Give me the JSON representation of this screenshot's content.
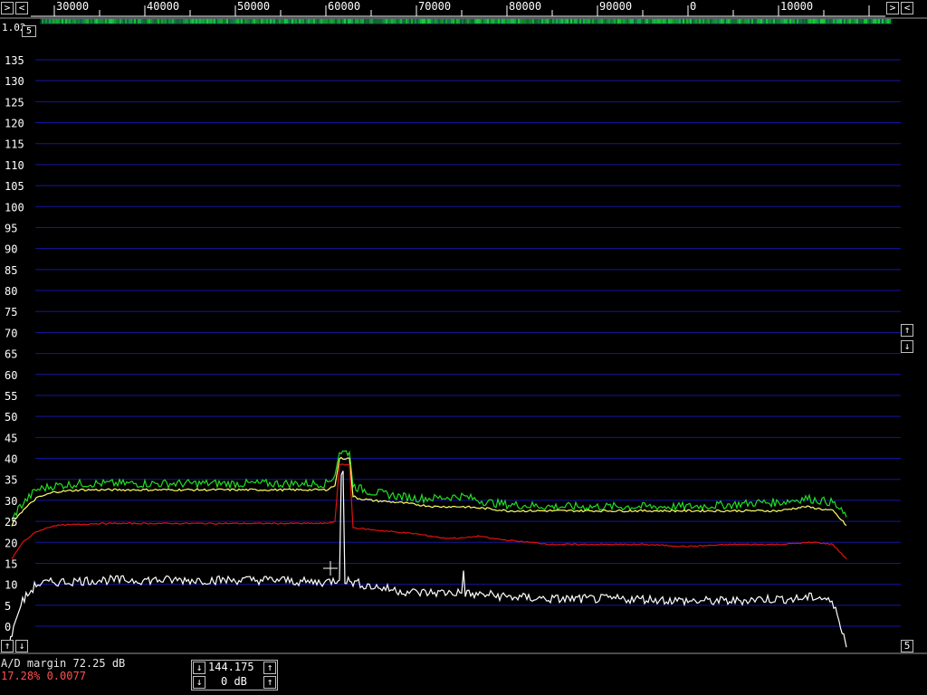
{
  "colors": {
    "grid": "#1515a0",
    "axis": "#ffffff",
    "trace_white": "#ffffff",
    "trace_yellow": "#ffff66",
    "trace_red": "#e01010",
    "trace_green": "#22dd22",
    "status_red": "#ff5050"
  },
  "freq_scale": {
    "labels": [
      "30000",
      "40000",
      "50000",
      "60000",
      "70000",
      "80000",
      "90000",
      "0",
      "10000"
    ]
  },
  "corner": {
    "readout": "1.02",
    "button_label": "5"
  },
  "status": {
    "ad_margin": "A/D margin 72.25 dB",
    "load": "17.28% 0.0077"
  },
  "controls": {
    "frequency": "144.175",
    "gain": "0 dB",
    "right_step": "5"
  },
  "chart_data": {
    "type": "line",
    "ylim": [
      -5,
      140
    ],
    "y_ticks": [
      135,
      130,
      125,
      120,
      115,
      110,
      105,
      100,
      95,
      90,
      85,
      80,
      75,
      70,
      65,
      60,
      55,
      50,
      45,
      40,
      35,
      30,
      25,
      20,
      15,
      10,
      5,
      0
    ],
    "xlim": [
      25000,
      120000
    ],
    "x_ticks": [
      30000,
      40000,
      50000,
      60000,
      70000,
      80000,
      90000,
      100000,
      110000
    ],
    "series": [
      {
        "color_key": "trace_green",
        "x": [
          25300,
          26000,
          28000,
          30000,
          33000,
          40000,
          50000,
          55000,
          58000,
          60000,
          61000,
          61500,
          62600,
          63000,
          63500,
          65000,
          68000,
          70000,
          72000,
          75000,
          78000,
          80000,
          85000,
          90000,
          100000,
          105000,
          108000,
          110000,
          113000,
          116000,
          117500
        ],
        "y": [
          25,
          28,
          32.5,
          33.5,
          34,
          34,
          34,
          34,
          34,
          34,
          36,
          41.5,
          41.5,
          33.5,
          33,
          32,
          31,
          30.5,
          30.5,
          31,
          29.5,
          29,
          28.5,
          28.5,
          28.5,
          29,
          29.5,
          29.5,
          30.5,
          29.5,
          26
        ]
      },
      {
        "color_key": "trace_yellow",
        "x": [
          25300,
          26000,
          28000,
          30000,
          33000,
          40000,
          50000,
          55000,
          58000,
          60000,
          61000,
          61500,
          62600,
          63000,
          63500,
          65000,
          68000,
          70000,
          72000,
          75000,
          78000,
          80000,
          85000,
          90000,
          100000,
          105000,
          108000,
          110000,
          113000,
          116000,
          117500
        ],
        "y": [
          24,
          26.5,
          30.5,
          32,
          32.5,
          32.5,
          32.5,
          32.5,
          32.5,
          32.5,
          33.5,
          40,
          40,
          31,
          30.5,
          30,
          29.5,
          29,
          28.5,
          28.5,
          28,
          27.5,
          27.5,
          27.5,
          27.5,
          27.5,
          27.5,
          27.5,
          28.5,
          27.5,
          24
        ]
      },
      {
        "color_key": "trace_red",
        "x": [
          25300,
          26500,
          28000,
          30000,
          35000,
          40000,
          50000,
          55000,
          59000,
          60000,
          61000,
          61500,
          62600,
          63000,
          65000,
          70000,
          73000,
          75000,
          77000,
          78000,
          80000,
          85000,
          90000,
          95000,
          100000,
          105000,
          110000,
          114000,
          116000,
          117500
        ],
        "y": [
          16,
          20,
          22.5,
          24,
          24.5,
          24.5,
          24.5,
          24.5,
          24.5,
          24.5,
          25,
          38.5,
          38.5,
          23.5,
          23,
          22,
          21,
          21,
          21.5,
          21,
          20.5,
          19.5,
          19.5,
          19.5,
          19,
          19.5,
          19.5,
          20,
          19.5,
          16
        ]
      },
      {
        "color_key": "trace_white",
        "x": [
          25000,
          25500,
          26500,
          28000,
          30000,
          35000,
          40000,
          45000,
          50000,
          55000,
          58000,
          60000,
          61000,
          61500,
          61700,
          61900,
          62100,
          63000,
          65000,
          68000,
          70000,
          72000,
          74000,
          75000,
          75200,
          75400,
          76000,
          78000,
          80000,
          85000,
          90000,
          95000,
          100000,
          105000,
          108000,
          110000,
          112000,
          114000,
          115500,
          116500,
          117200,
          117500
        ],
        "y": [
          -5,
          0,
          6,
          10,
          10.5,
          11,
          11,
          11,
          11,
          11,
          10.5,
          10.5,
          11,
          11,
          37,
          37,
          11,
          10.5,
          9.5,
          8.5,
          8,
          8,
          8,
          8,
          13,
          8,
          7.5,
          7.5,
          7,
          6.5,
          6.5,
          6.5,
          6,
          6,
          6.5,
          6.5,
          6.5,
          7,
          6.5,
          3,
          -2,
          -5
        ]
      }
    ]
  }
}
